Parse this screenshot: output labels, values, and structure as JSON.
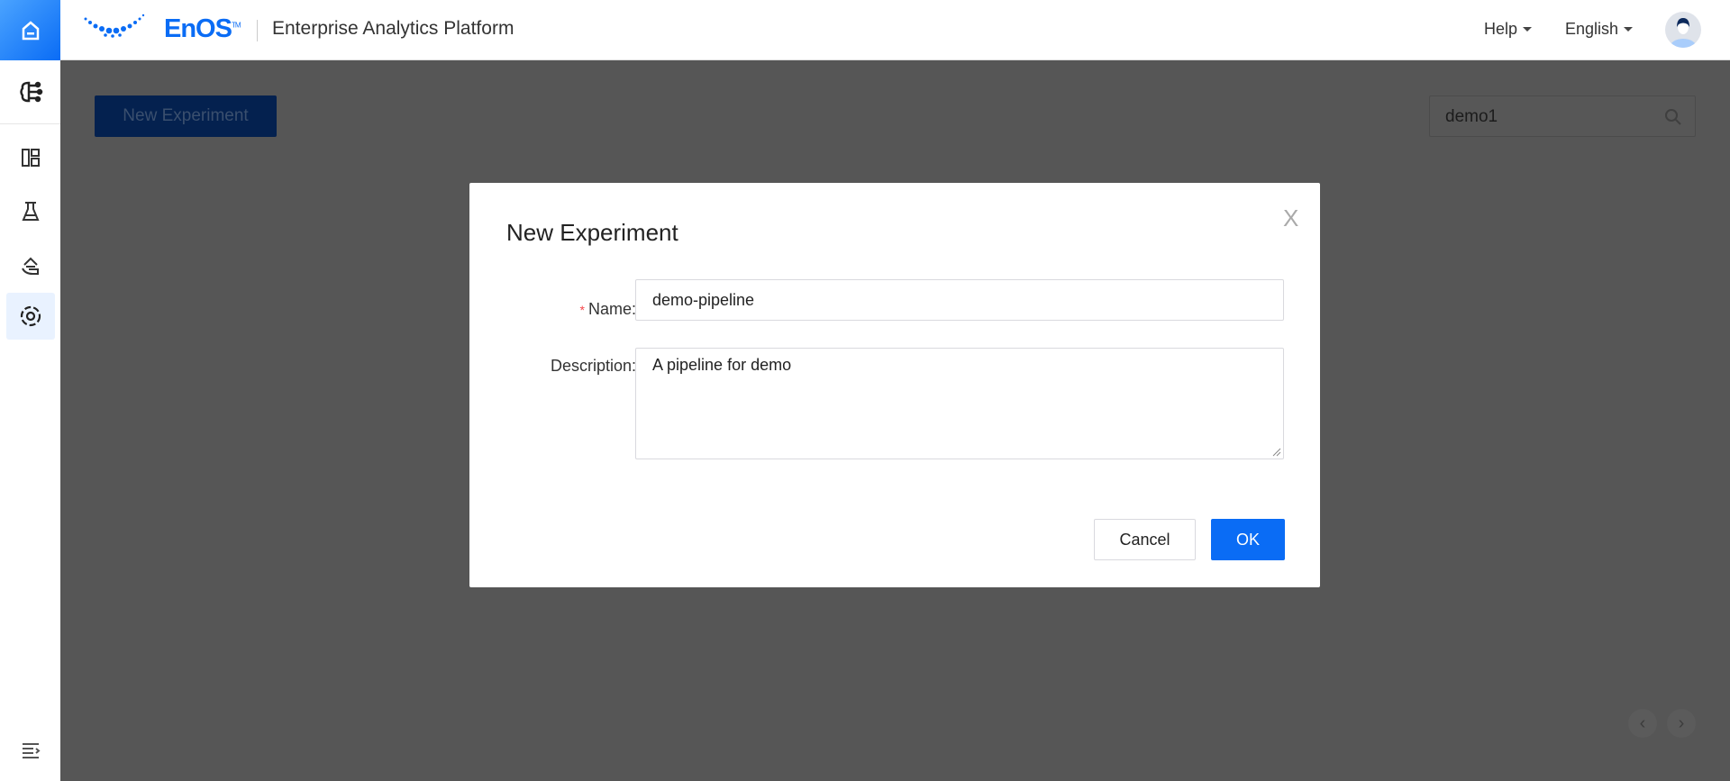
{
  "header": {
    "brand": "EnOS",
    "trademark": "TM",
    "app_title": "Enterprise Analytics Platform",
    "help": "Help",
    "language": "English"
  },
  "sidebar": {
    "items": [
      {
        "icon": "ai-network-icon"
      },
      {
        "icon": "dashboard-icon"
      },
      {
        "icon": "flask-icon"
      },
      {
        "icon": "hand-model-icon"
      },
      {
        "icon": "pipeline-target-icon",
        "active": true
      }
    ]
  },
  "main": {
    "new_experiment": "New Experiment",
    "search_value": "demo1"
  },
  "modal": {
    "title": "New Experiment",
    "name_label": "Name:",
    "name_value": "demo-pipeline",
    "description_label": "Description:",
    "description_value": "A pipeline for demo",
    "cancel": "Cancel",
    "ok": "OK",
    "close": "X"
  },
  "colors": {
    "primary": "#0a6cf5",
    "mask": "#565656",
    "required": "#f5464a"
  }
}
